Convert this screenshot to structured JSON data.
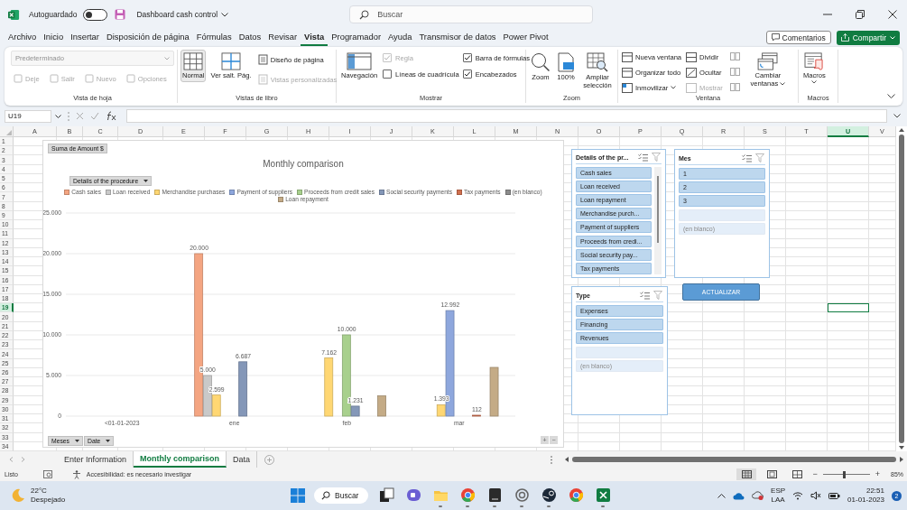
{
  "title_bar": {
    "autosave_label": "Autoguardado",
    "autosave_on": false,
    "document_title": "Dashboard cash control",
    "search_placeholder": "Buscar"
  },
  "menu_tabs": [
    {
      "label": "Archivo",
      "selected": false
    },
    {
      "label": "Inicio",
      "selected": false
    },
    {
      "label": "Insertar",
      "selected": false
    },
    {
      "label": "Disposición de página",
      "selected": false
    },
    {
      "label": "Fórmulas",
      "selected": false
    },
    {
      "label": "Datos",
      "selected": false
    },
    {
      "label": "Revisar",
      "selected": false
    },
    {
      "label": "Vista",
      "selected": true
    },
    {
      "label": "Programador",
      "selected": false
    },
    {
      "label": "Ayuda",
      "selected": false
    },
    {
      "label": "Transmisor de datos",
      "selected": false
    },
    {
      "label": "Power Pivot",
      "selected": false
    }
  ],
  "comments_button": "Comentarios",
  "share_button": "Compartir",
  "ribbon": {
    "groups": [
      {
        "label": "Vista de hoja",
        "items": [
          {
            "label": "Predeterminado",
            "disabled": true
          },
          {
            "label": "Deje",
            "disabled": true
          },
          {
            "label": "Salir",
            "disabled": true
          },
          {
            "label": "Nuevo",
            "disabled": true
          },
          {
            "label": "Opciones",
            "disabled": true
          }
        ]
      },
      {
        "label": "Vistas de libro",
        "items": [
          {
            "label": "Normal",
            "disabled": false,
            "selected": true
          },
          {
            "label": "Ver salt. Pág.",
            "disabled": false,
            "selected": false
          },
          {
            "label": "Diseño de página",
            "disabled": false,
            "selected": false
          },
          {
            "label": "Vistas personalizadas",
            "disabled": true,
            "selected": false
          }
        ]
      },
      {
        "label": "Mostrar",
        "items": [
          {
            "label": "Navegación",
            "disabled": false
          },
          {
            "label": "Regla",
            "disabled": true,
            "checked": true
          },
          {
            "label": "Líneas de cuadrícula",
            "disabled": false,
            "checked": false
          },
          {
            "label": "Barra de fórmulas",
            "disabled": false,
            "checked": true
          },
          {
            "label": "Encabezados",
            "disabled": false,
            "checked": true
          }
        ]
      },
      {
        "label": "Zoom",
        "items": [
          {
            "label": "Zoom",
            "disabled": false
          },
          {
            "label": "100%",
            "disabled": false
          },
          {
            "label": "Ampliar selección",
            "disabled": false
          }
        ]
      },
      {
        "label": "Ventana",
        "items": [
          {
            "label": "Nueva ventana",
            "disabled": false
          },
          {
            "label": "Organizar todo",
            "disabled": false
          },
          {
            "label": "Inmovilizar",
            "disabled": false
          },
          {
            "label": "Dividir",
            "disabled": false
          },
          {
            "label": "Ocultar",
            "disabled": false
          },
          {
            "label": "Mostrar",
            "disabled": true
          },
          {
            "disabled": true
          },
          {
            "disabled": true
          },
          {
            "disabled": true
          },
          {
            "label": "Cambiar ventanas",
            "disabled": false
          }
        ]
      },
      {
        "label": "Macros",
        "items": [
          {
            "label": "Macros",
            "disabled": false
          }
        ]
      }
    ]
  },
  "formula_bar": {
    "name_box": "U19"
  },
  "sheet": {
    "columns": [
      {
        "label": "A",
        "selected": false
      },
      {
        "label": "B",
        "selected": false
      },
      {
        "label": "C",
        "selected": false
      },
      {
        "label": "D",
        "selected": false
      },
      {
        "label": "E",
        "selected": false
      },
      {
        "label": "F",
        "selected": false
      },
      {
        "label": "G",
        "selected": false
      },
      {
        "label": "H",
        "selected": false
      },
      {
        "label": "I",
        "selected": false
      },
      {
        "label": "J",
        "selected": false
      },
      {
        "label": "K",
        "selected": false
      },
      {
        "label": "L",
        "selected": false
      },
      {
        "label": "M",
        "selected": false
      },
      {
        "label": "N",
        "selected": false
      },
      {
        "label": "O",
        "selected": false
      },
      {
        "label": "P",
        "selected": false
      },
      {
        "label": "Q",
        "selected": false
      },
      {
        "label": "R",
        "selected": false
      },
      {
        "label": "S",
        "selected": false
      },
      {
        "label": "T",
        "selected": false
      },
      {
        "label": "U",
        "selected": true
      },
      {
        "label": "V",
        "selected": false
      }
    ],
    "rows": [
      {
        "label": "1",
        "selected": false
      },
      {
        "label": "2",
        "selected": false
      },
      {
        "label": "3",
        "selected": false
      },
      {
        "label": "4",
        "selected": false
      },
      {
        "label": "5",
        "selected": false
      },
      {
        "label": "6",
        "selected": false
      },
      {
        "label": "7",
        "selected": false
      },
      {
        "label": "8",
        "selected": false
      },
      {
        "label": "9",
        "selected": false
      },
      {
        "label": "10",
        "selected": false
      },
      {
        "label": "11",
        "selected": false
      },
      {
        "label": "12",
        "selected": false
      },
      {
        "label": "13",
        "selected": false
      },
      {
        "label": "14",
        "selected": false
      },
      {
        "label": "15",
        "selected": false
      },
      {
        "label": "16",
        "selected": false
      },
      {
        "label": "17",
        "selected": false
      },
      {
        "label": "18",
        "selected": false
      },
      {
        "label": "19",
        "selected": true
      },
      {
        "label": "20",
        "selected": false
      },
      {
        "label": "21",
        "selected": false
      },
      {
        "label": "22",
        "selected": false
      },
      {
        "label": "23",
        "selected": false
      },
      {
        "label": "24",
        "selected": false
      },
      {
        "label": "25",
        "selected": false
      },
      {
        "label": "26",
        "selected": false
      },
      {
        "label": "27",
        "selected": false
      },
      {
        "label": "28",
        "selected": false
      },
      {
        "label": "29",
        "selected": false
      },
      {
        "label": "30",
        "selected": false
      },
      {
        "label": "31",
        "selected": false
      },
      {
        "label": "32",
        "selected": false
      },
      {
        "label": "33",
        "selected": false
      },
      {
        "label": "34",
        "selected": false
      }
    ]
  },
  "pivot_chart": {
    "value_field": "Suma de Amount $",
    "legend_field": "Details of the procedure",
    "axis_fields": [
      "Meses",
      "Date"
    ],
    "expand_buttons": [
      "+",
      "−"
    ],
    "chart_data": {
      "type": "bar",
      "title": "Monthly comparison",
      "orientation": "vertical",
      "grid": true,
      "legend": true,
      "categories": [
        "<01-01-2023",
        "ene",
        "feb",
        "mar"
      ],
      "series": [
        {
          "name": "Cash sales",
          "color": "#f4a582",
          "values": [
            null,
            20000,
            null,
            null
          ],
          "value_labels": [
            null,
            "20.000",
            null,
            null
          ]
        },
        {
          "name": "Loan received",
          "color": "#c9c9c9",
          "values": [
            null,
            5000,
            null,
            null
          ],
          "value_labels": [
            null,
            "5.000",
            null,
            null
          ]
        },
        {
          "name": "Merchandise purchases",
          "color": "#ffd773",
          "values": [
            null,
            2599,
            7162,
            1393
          ],
          "value_labels": [
            null,
            "2.599",
            "7.162",
            "1.393"
          ]
        },
        {
          "name": "Payment of suppliers",
          "color": "#8ea7dd",
          "values": [
            null,
            null,
            null,
            12992
          ],
          "value_labels": [
            null,
            null,
            null,
            "12.992"
          ]
        },
        {
          "name": "Proceeds from credit sales",
          "color": "#a8d08d",
          "values": [
            null,
            null,
            10000,
            null
          ],
          "value_labels": [
            null,
            null,
            "10.000",
            null
          ]
        },
        {
          "name": "Social security payments",
          "color": "#8497b8",
          "values": [
            null,
            6687,
            1231,
            null
          ],
          "value_labels": [
            null,
            "6.687",
            "1.231",
            null
          ]
        },
        {
          "name": "Tax payments",
          "color": "#d0704f",
          "values": [
            null,
            null,
            null,
            112
          ],
          "value_labels": [
            null,
            null,
            null,
            "112"
          ]
        },
        {
          "name": "(en blanco)",
          "color": "#8c8c8c",
          "values": [
            null,
            null,
            null,
            null
          ]
        },
        {
          "name": "Loan repayment",
          "color": "#c4ab86",
          "values": [
            null,
            null,
            2500,
            6000
          ]
        }
      ],
      "ylim": [
        0,
        25000
      ],
      "yticks": [
        {
          "value": 0,
          "label": "0"
        },
        {
          "value": 5000,
          "label": "5.000"
        },
        {
          "value": 10000,
          "label": "10.000"
        },
        {
          "value": 15000,
          "label": "15.000"
        },
        {
          "value": 20000,
          "label": "20.000"
        },
        {
          "value": 25000,
          "label": "25.000"
        }
      ]
    }
  },
  "slicers": [
    {
      "title": "Details of the pr...",
      "scrollable": true,
      "items": [
        {
          "label": "Cash sales",
          "selected": true,
          "has_data": true
        },
        {
          "label": "Loan received",
          "selected": true,
          "has_data": true
        },
        {
          "label": "Loan repayment",
          "selected": true,
          "has_data": true
        },
        {
          "label": "Merchandise purch...",
          "selected": true,
          "has_data": true
        },
        {
          "label": "Payment of suppliers",
          "selected": true,
          "has_data": true
        },
        {
          "label": "Proceeds from credi...",
          "selected": true,
          "has_data": true
        },
        {
          "label": "Social security pay...",
          "selected": true,
          "has_data": true
        },
        {
          "label": "Tax payments",
          "selected": true,
          "has_data": true
        }
      ]
    },
    {
      "title": "Mes",
      "scrollable": false,
      "items": [
        {
          "label": "1",
          "selected": true,
          "has_data": true
        },
        {
          "label": "2",
          "selected": true,
          "has_data": true
        },
        {
          "label": "3",
          "selected": true,
          "has_data": true
        },
        {
          "selected": true,
          "has_data": false
        },
        {
          "label": "(en blanco)",
          "selected": true,
          "has_data": false
        }
      ]
    },
    {
      "title": "Type",
      "scrollable": false,
      "items": [
        {
          "label": "Expenses",
          "selected": true,
          "has_data": true
        },
        {
          "label": "Financing",
          "selected": true,
          "has_data": true
        },
        {
          "label": "Revenues",
          "selected": true,
          "has_data": true
        },
        {
          "selected": true,
          "has_data": false
        },
        {
          "label": "(en blanco)",
          "selected": true,
          "has_data": false
        }
      ]
    }
  ],
  "refresh_button": "ACTUALIZAR",
  "sheet_tabs": [
    {
      "label": "Enter Information",
      "selected": false
    },
    {
      "label": "Monthly comparison",
      "selected": true
    },
    {
      "label": "Data",
      "selected": false
    }
  ],
  "status_bar": {
    "ready": "Listo",
    "accessibility": "Accesibilidad: es necesario investigar",
    "views": [
      {
        "selected": true
      },
      {
        "selected": false
      },
      {
        "selected": false
      }
    ],
    "zoom": {
      "zoom_out": "−",
      "zoom_in": "+",
      "level": 0.45,
      "reading": "85%"
    }
  },
  "taskbar": {
    "temperature": "22°C",
    "weather": "Despejado",
    "search": "Buscar",
    "apps": [
      {
        "running": false
      },
      {
        "running": false
      },
      {
        "running": true
      },
      {
        "running": true
      },
      {
        "running": true
      },
      {
        "running": true
      },
      {
        "running": true
      },
      {
        "running": false
      },
      {
        "running": true
      }
    ],
    "language": "ESP",
    "layout": "LAA",
    "time": "22:51",
    "date": "01-01-2023",
    "notifications": "2"
  }
}
